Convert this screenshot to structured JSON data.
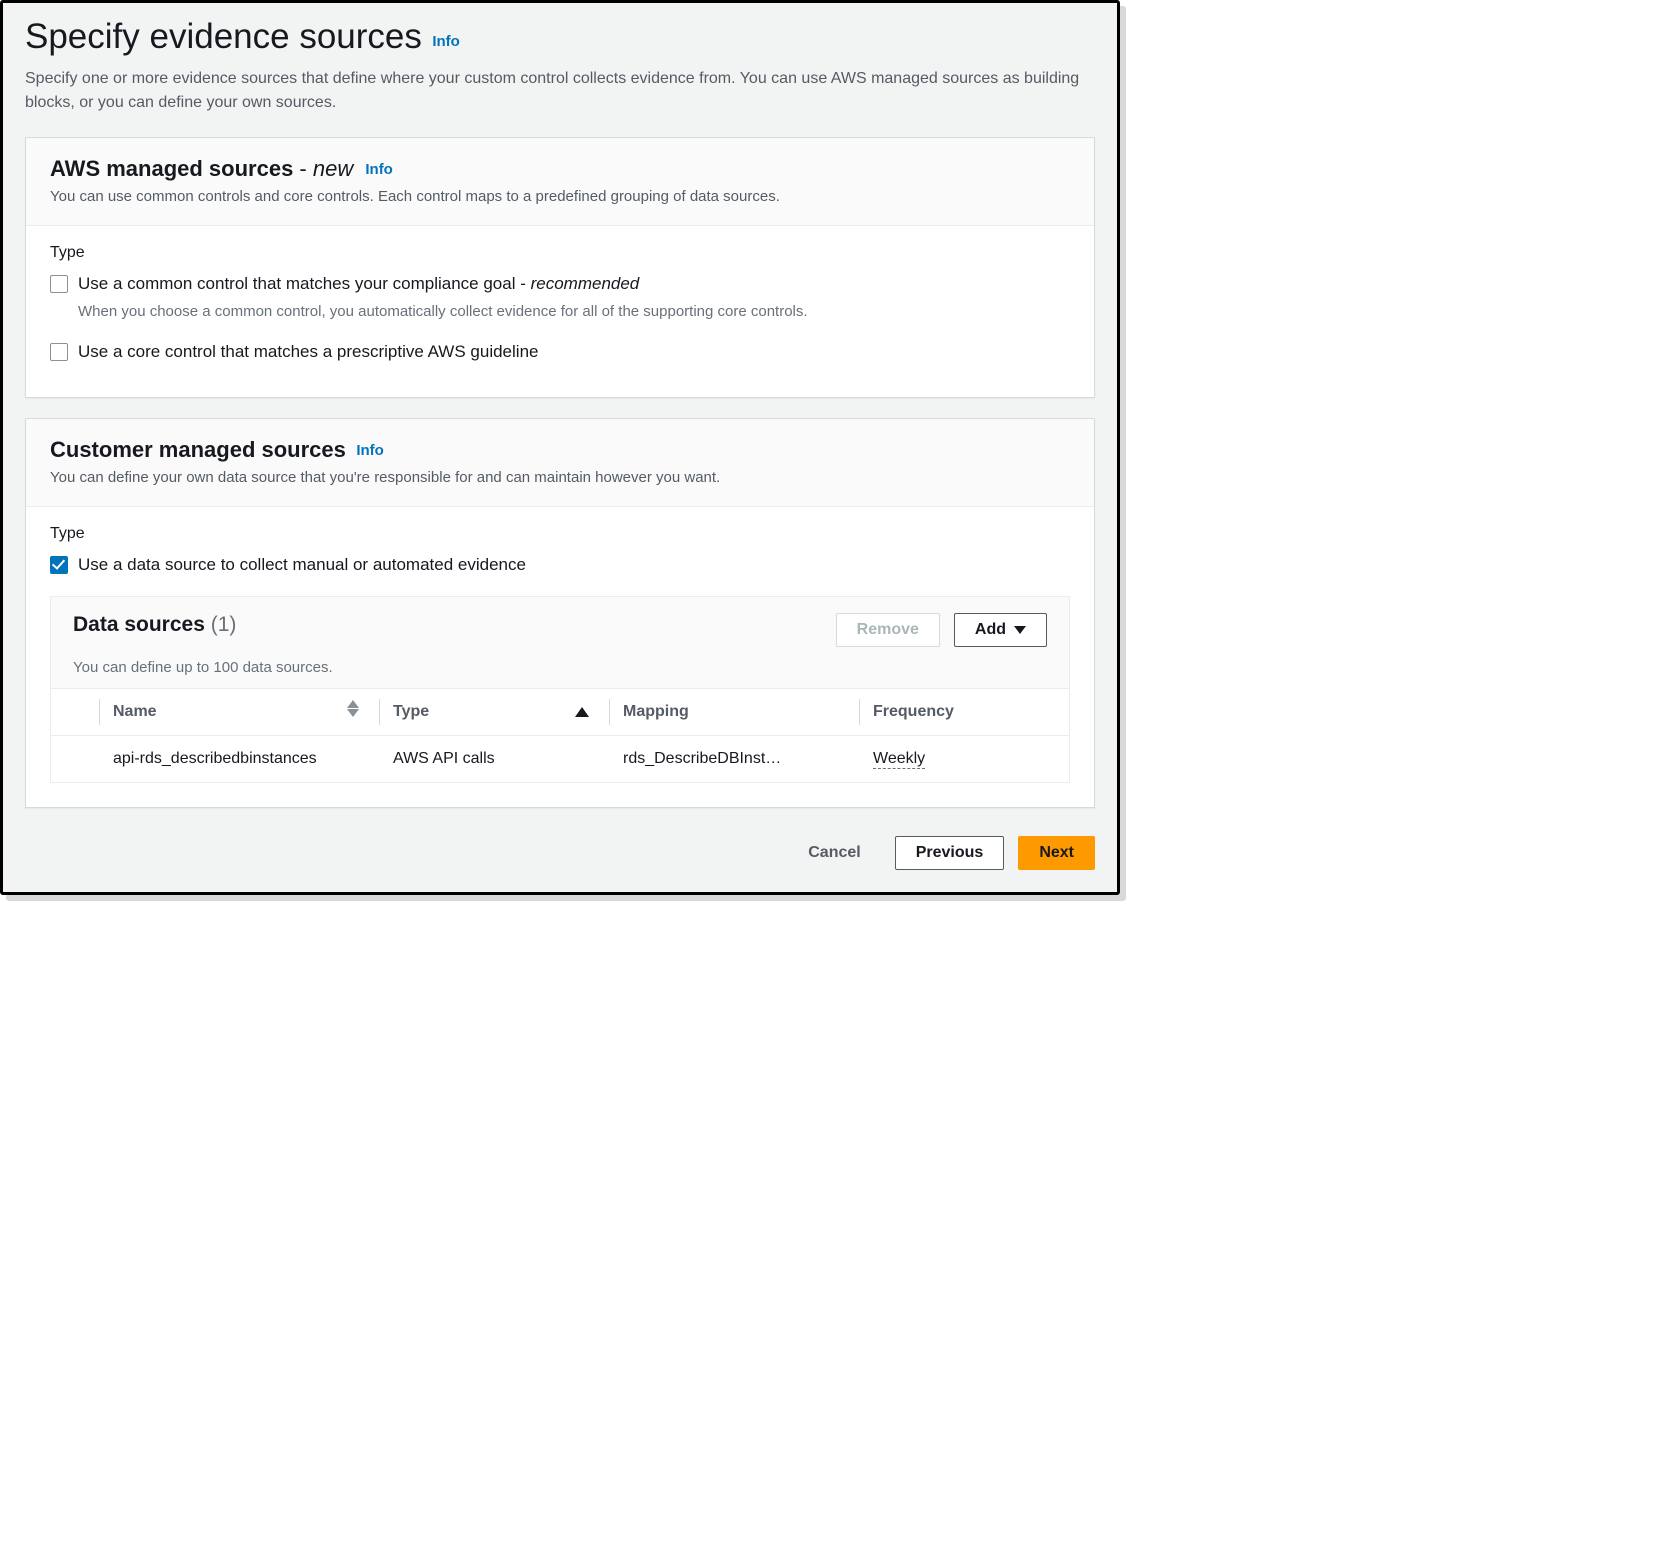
{
  "header": {
    "title": "Specify evidence sources",
    "info": "Info",
    "description": "Specify one or more evidence sources that define where your custom control collects evidence from. You can use AWS managed sources as building blocks, or you can define your own sources."
  },
  "aws_panel": {
    "title_main": "AWS managed sources ",
    "title_dash": "- ",
    "title_new": "new",
    "info": "Info",
    "subtext": "You can use common controls and core controls. Each control maps to a predefined grouping of data sources.",
    "type_label": "Type",
    "opt_common_prefix": "Use a common control that matches your compliance goal - ",
    "opt_common_reco": "recommended",
    "opt_common_hint": "When you choose a common control, you automatically collect evidence for all of the supporting core controls.",
    "opt_core": "Use a core control that matches a prescriptive AWS guideline"
  },
  "customer_panel": {
    "title": "Customer managed sources",
    "info": "Info",
    "subtext": "You can define your own data source that you're responsible for and can maintain however you want.",
    "type_label": "Type",
    "opt_datasource": "Use a data source to collect manual or automated evidence",
    "ds_title": "Data sources",
    "ds_count": "(1)",
    "ds_sub": "You can define up to 100 data sources.",
    "remove": "Remove",
    "add": "Add",
    "columns": {
      "name": "Name",
      "type": "Type",
      "mapping": "Mapping",
      "frequency": "Frequency"
    },
    "rows": [
      {
        "name": "api-rds_describedbinstances",
        "type": "AWS API calls",
        "mapping": "rds_DescribeDBInst…",
        "frequency": "Weekly"
      }
    ]
  },
  "wizard": {
    "cancel": "Cancel",
    "previous": "Previous",
    "next": "Next"
  }
}
